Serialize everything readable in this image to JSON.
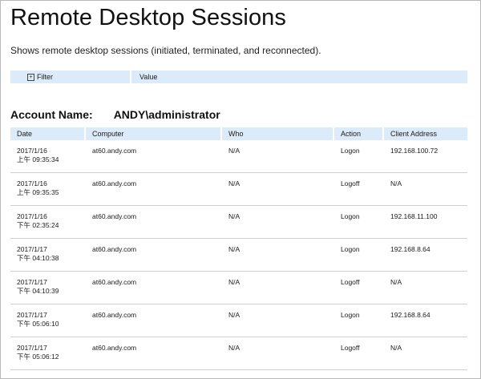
{
  "page": {
    "title": "Remote Desktop Sessions",
    "subtitle": "Shows remote desktop sessions (initiated, terminated, and reconnected)."
  },
  "filter_bar": {
    "filter_label": "Filter",
    "value_label": "Value"
  },
  "account": {
    "label": "Account Name:",
    "value": "ANDY\\administrator"
  },
  "table": {
    "columns": [
      "Date",
      "Computer",
      "Who",
      "Action",
      "Client Address"
    ],
    "rows": [
      {
        "date": "2017/1/16",
        "time": "上午 09:35:34",
        "computer": "at60.andy.com",
        "who": "N/A",
        "action": "Logon",
        "client": "192.168.100.72"
      },
      {
        "date": "2017/1/16",
        "time": "上午 09:35:35",
        "computer": "at60.andy.com",
        "who": "N/A",
        "action": "Logoff",
        "client": "N/A"
      },
      {
        "date": "2017/1/16",
        "time": "下午 02:35:24",
        "computer": "at60.andy.com",
        "who": "N/A",
        "action": "Logon",
        "client": "192.168.11.100"
      },
      {
        "date": "2017/1/17",
        "time": "下午 04:10:38",
        "computer": "at60.andy.com",
        "who": "N/A",
        "action": "Logon",
        "client": "192.168.8.64"
      },
      {
        "date": "2017/1/17",
        "time": "下午 04:10:39",
        "computer": "at60.andy.com",
        "who": "N/A",
        "action": "Logoff",
        "client": "N/A"
      },
      {
        "date": "2017/1/17",
        "time": "下午 05:06:10",
        "computer": "at60.andy.com",
        "who": "N/A",
        "action": "Logon",
        "client": "192.168.8.64"
      },
      {
        "date": "2017/1/17",
        "time": "下午 05:06:12",
        "computer": "at60.andy.com",
        "who": "N/A",
        "action": "Logoff",
        "client": "N/A"
      }
    ]
  }
}
